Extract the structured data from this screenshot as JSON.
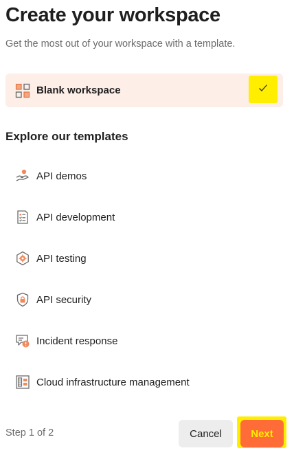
{
  "header": {
    "title": "Create your workspace",
    "subtitle": "Get the most out of your workspace with a template."
  },
  "blank_option": {
    "label": "Blank workspace",
    "selected": true,
    "icon": "grid-icon"
  },
  "templates_section": {
    "heading": "Explore our templates",
    "items": [
      {
        "label": "API demos",
        "icon": "hand-demo-icon"
      },
      {
        "label": "API development",
        "icon": "checklist-document-icon"
      },
      {
        "label": "API testing",
        "icon": "hexagon-gear-icon"
      },
      {
        "label": "API security",
        "icon": "shield-lock-icon"
      },
      {
        "label": "Incident response",
        "icon": "alert-chat-icon"
      },
      {
        "label": "Cloud infrastructure management",
        "icon": "server-cloud-icon"
      }
    ]
  },
  "footer": {
    "step_text": "Step 1 of 2",
    "cancel_label": "Cancel",
    "next_label": "Next"
  },
  "colors": {
    "accent": "#ff6c37",
    "selected_bg": "#fdeee8",
    "highlight": "#ffee00",
    "icon_stroke": "#6b6b6b"
  }
}
